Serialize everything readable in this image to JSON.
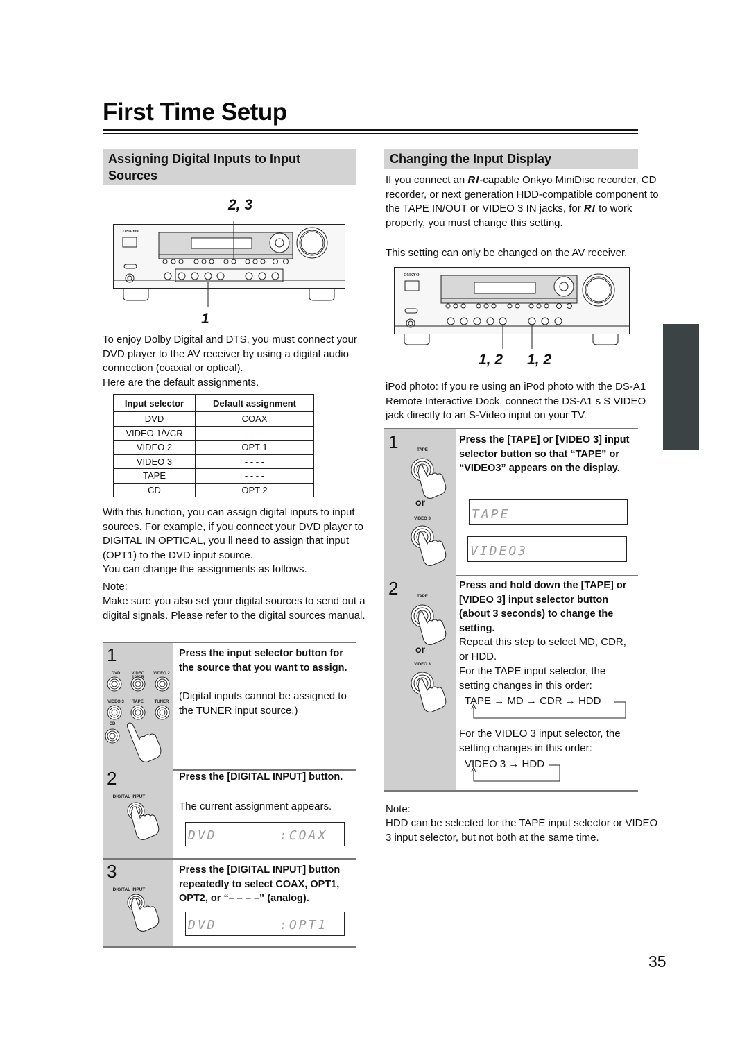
{
  "page": {
    "title": "First Time Setup",
    "page_number": "35"
  },
  "left": {
    "heading": "Assigning Digital Inputs to Input Sources",
    "figure_callouts": {
      "top": "2, 3",
      "bottom": "1"
    },
    "intro": "To enjoy Dolby Digital and DTS, you must connect your DVD player to the AV receiver by using a digital audio connection (coaxial or optical).",
    "table_intro": "Here are the default assignments.",
    "table": {
      "headers": [
        "Input selector",
        "Default assignment"
      ],
      "rows": [
        [
          "DVD",
          "COAX"
        ],
        [
          "VIDEO 1/VCR",
          "- - - -"
        ],
        [
          "VIDEO 2",
          "OPT 1"
        ],
        [
          "VIDEO 3",
          "- - - -"
        ],
        [
          "TAPE",
          "- - - -"
        ],
        [
          "CD",
          "OPT 2"
        ]
      ]
    },
    "function_text": "With this function, you can assign digital inputs to input sources. For example, if you connect your DVD player to DIGITAL IN OPTICAL, you ll need to assign that input (OPT1) to the DVD input source.",
    "change_text": "You can change the assignments as follows.",
    "note_label": "Note:",
    "note_text": "Make sure you also set your digital sources to send out a digital signals. Please refer to the digital sources  manual.",
    "steps": [
      {
        "number": "1",
        "bold": "Press the input selector button for the source that you want to assign.",
        "text": "(Digital inputs cannot be assigned to the TUNER input source.)",
        "buttons": [
          "DVD",
          "VIDEO 1/VCR",
          "VIDEO 2",
          "VIDEO 3",
          "TAPE",
          "TUNER",
          "CD"
        ]
      },
      {
        "number": "2",
        "button_label": "DIGITAL INPUT",
        "bold": "Press the [DIGITAL INPUT] button.",
        "text": "The current assignment appears.",
        "display": {
          "left": "DVD",
          "right": ":COAX"
        }
      },
      {
        "number": "3",
        "button_label": "DIGITAL INPUT",
        "bold": "Press the [DIGITAL INPUT] button repeatedly to select COAX, OPT1, OPT2, or “– – – –” (analog).",
        "display": {
          "left": "DVD",
          "right": ":OPT1"
        }
      }
    ]
  },
  "right": {
    "heading": "Changing the Input Display",
    "intro_parts": [
      "If you connect an ",
      "-capable Onkyo MiniDisc recorder, CD recorder, or next generation HDD-compatible component to the TAPE IN/OUT or VIDEO 3 IN jacks, for ",
      " to work properly, you must change this setting."
    ],
    "ri_logo": "RI",
    "receiver_only": "This setting can only be changed on the AV receiver.",
    "figure_callouts": [
      "1, 2",
      "1, 2"
    ],
    "ipod_text": "iPod photo: If you re using an iPod photo with the DS-A1 Remote Interactive Dock, connect the DS-A1 s S VIDEO jack directly to an S-Video input on your TV.",
    "steps": [
      {
        "number": "1",
        "buttons": [
          "TAPE",
          "VIDEO 3"
        ],
        "or": "or",
        "bold": "Press the [TAPE] or [VIDEO 3] input selector button so that “TAPE” or “VIDEO3” appears on the display.",
        "displays": [
          "TAPE",
          "VIDEO3"
        ]
      },
      {
        "number": "2",
        "buttons": [
          "TAPE",
          "VIDEO 3"
        ],
        "or": "or",
        "bold": "Press and hold down the [TAPE] or [VIDEO 3] input selector button (about 3 seconds) to change the setting.",
        "repeat_text": "Repeat this step to select MD, CDR, or HDD.",
        "tape_intro": "For the TAPE input selector, the setting changes in this order:",
        "tape_cycle": [
          "TAPE",
          "MD",
          "CDR",
          "HDD"
        ],
        "video3_intro": "For the VIDEO 3 input selector, the setting changes in this order:",
        "video3_cycle": [
          "VIDEO 3",
          "HDD"
        ]
      }
    ],
    "note_label": "Note:",
    "note_text": "HDD can be selected for the TAPE input selector or VIDEO 3 input selector, but not both at the same time.",
    "arrow_glyph": "→"
  },
  "receiver": {
    "brand": "ONKYO"
  }
}
